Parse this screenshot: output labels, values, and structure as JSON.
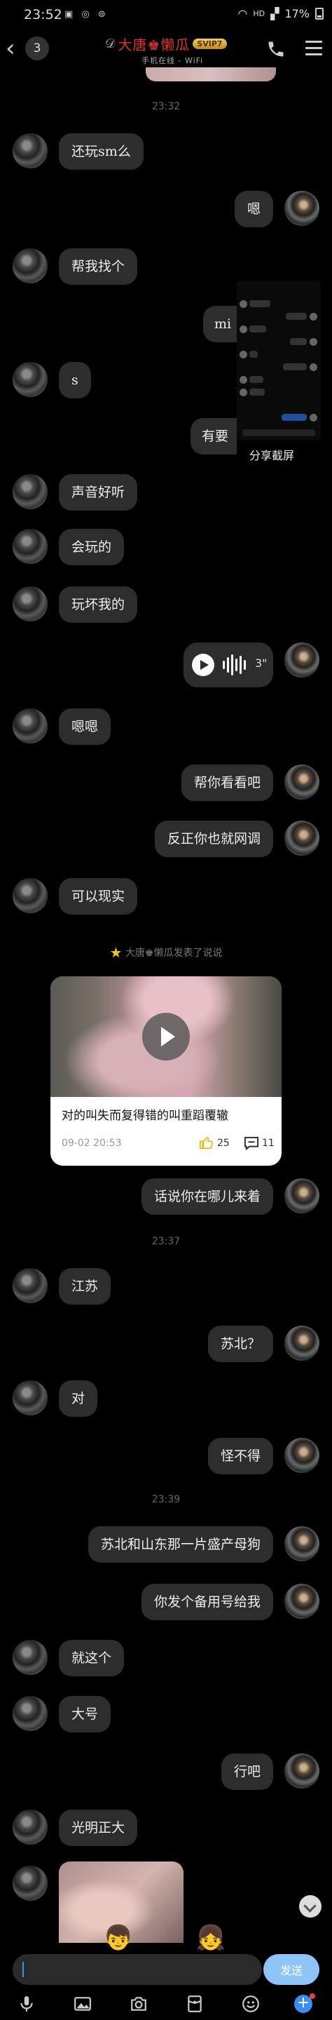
{
  "status_bar": {
    "time": "23:52",
    "icons_left": "▣ ◎ ⊚",
    "network": "HD",
    "battery": "17%"
  },
  "header": {
    "unread_count": "3",
    "contact_name": "大唐♚懒瓜",
    "vip_badge": "SVIP7",
    "online_status": "手机在线 - WiFi"
  },
  "timestamps": [
    "23:32",
    "23:37",
    "23:39"
  ],
  "messages": {
    "m1": "还玩sm么",
    "m2": "嗯",
    "m3": "帮我找个",
    "m4": "mi",
    "m5": "s",
    "m6": "有要",
    "m7": "声音好听",
    "m8": "会玩的",
    "m9": "玩坏我的",
    "m10": "嗯嗯",
    "m11": "帮你看看吧",
    "m12": "反正你也就网调",
    "m13": "可以现实",
    "m14": "话说你在哪儿来着",
    "m15": "江苏",
    "m16": "苏北？",
    "m17": "对",
    "m18": "怪不得",
    "m19": "苏北和山东那一片盛产母狗",
    "m20": "你发个备用号给我",
    "m21": "就这个",
    "m22": "大号",
    "m23": "行吧",
    "m24": "光明正大"
  },
  "screenshot_share": {
    "label": "分享截屏"
  },
  "voice": {
    "duration": "3\""
  },
  "moment": {
    "notice": "大唐♚懒瓜发表了说说",
    "caption": "对的叫失而复得错的叫重蹈覆辙",
    "date": "09-02 20:53",
    "likes": "25",
    "comments": "11"
  },
  "input": {
    "placeholder": "",
    "send_label": "发送"
  },
  "colors": {
    "bubble": "#2d2d2d",
    "accent": "#3a8df5",
    "name": "#dd3333",
    "vip": "#e0b040"
  }
}
